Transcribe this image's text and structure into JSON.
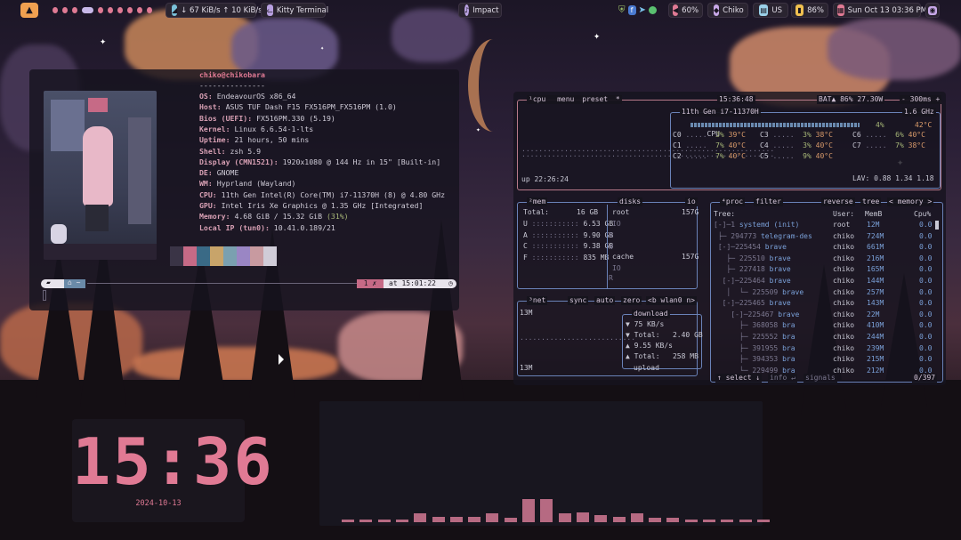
{
  "topbar": {
    "left": {
      "launcher_icon": "arch-logo-icon",
      "net_stats": "↓ 67 KiB/s ↑ 10 KiB/s",
      "active_window": "Kitty Terminal"
    },
    "center": {
      "media": "Impact"
    },
    "right": {
      "tray_icons": [
        "shield-icon",
        "file-icon",
        "telegram-icon",
        "spotify-icon"
      ],
      "volume": "60%",
      "user": "Chiko",
      "keyboard_layout": "US",
      "battery": "86%",
      "datetime": "Sun Oct 13  03:36 PM"
    }
  },
  "fastfetch": {
    "header": "chiko@chikobara",
    "separator": "---------------",
    "lines": [
      {
        "key": "OS:",
        "value": " EndeavourOS x86_64"
      },
      {
        "key": "Host:",
        "value": " ASUS TUF Dash F15 FX516PM_FX516PM (1.0)"
      },
      {
        "key": "Bios (UEFI):",
        "value": " FX516PM.330 (5.19)"
      },
      {
        "key": "Kernel:",
        "value": " Linux 6.6.54-1-lts"
      },
      {
        "key": "Uptime:",
        "value": " 21 hours, 50 mins"
      },
      {
        "key": "Shell:",
        "value": " zsh 5.9"
      },
      {
        "key": "Display (CMN1521):",
        "value": " 1920x1080 @ 144 Hz in 15\" [Built-in]"
      },
      {
        "key": "DE:",
        "value": " GNOME"
      },
      {
        "key": "WM:",
        "value": " Hyprland (Wayland)"
      },
      {
        "key": "CPU:",
        "value": " 11th Gen Intel(R) Core(TM) i7-11370H (8) @ 4.80 GHz"
      },
      {
        "key": "GPU:",
        "value": " Intel Iris Xe Graphics @ 1.35 GHz [Integrated]"
      },
      {
        "key": "Memory:",
        "value": " 4.68 GiB / 15.32 GiB ",
        "extra": "(31%)"
      },
      {
        "key": "Local IP (tun0):",
        "value": " 10.41.0.189/21"
      }
    ],
    "palette": [
      "#3a3446",
      "#c66a86",
      "#3a6a86",
      "#c8a46a",
      "#7aa0b0",
      "#9a86c4",
      "#c89aa0",
      "#d0ccd8"
    ],
    "prompt": {
      "status": "1 ✗",
      "time": "at 15:01:22"
    }
  },
  "btop": {
    "cpu": {
      "tabs": [
        "¹cpu",
        "menu",
        "preset",
        "*"
      ],
      "clock": "15:36:48",
      "battery": "BAT▲ 86% 27.30W",
      "refresh": "- 300ms +",
      "model": "11th Gen i7-11370H",
      "freq": "1.6 GHz",
      "total_label": "CPU",
      "total_pct": "4%",
      "total_temp": "42°C",
      "cores": [
        {
          "name": "C0",
          "pct": "3%",
          "temp": "39°C"
        },
        {
          "name": "C1",
          "pct": "7%",
          "temp": "40°C"
        },
        {
          "name": "C2",
          "pct": "7%",
          "temp": "40°C"
        },
        {
          "name": "C3",
          "pct": "3%",
          "temp": "38°C"
        },
        {
          "name": "C4",
          "pct": "3%",
          "temp": "40°C"
        },
        {
          "name": "C5",
          "pct": "9%",
          "temp": "40°C"
        },
        {
          "name": "C6",
          "pct": "6%",
          "temp": "40°C"
        },
        {
          "name": "C7",
          "pct": "7%",
          "temp": "38°C"
        }
      ],
      "load": "LAV: 0.88 1.34 1.18",
      "uptime": "up 22:26:24"
    },
    "mem": {
      "title": "²mem",
      "total_label": "Total:",
      "total": "16 GB",
      "rows": [
        {
          "k": "U",
          "v": "6.53 GB"
        },
        {
          "k": "A",
          "v": "9.90 GB"
        },
        {
          "k": "C",
          "v": "9.38 GB"
        },
        {
          "k": "F",
          "v": "835 MB"
        }
      ]
    },
    "disks": {
      "title": "disks",
      "io": "io",
      "root": "root",
      "root_size": "157G",
      "cache": "cache",
      "cache_size": "157G",
      "io_label": "IO",
      "r": "R",
      "w": "W"
    },
    "net": {
      "title": "³net",
      "tabs": [
        "sync",
        "auto",
        "zero",
        "<b wlan0 n>"
      ],
      "top_scale": "13M",
      "bottom_scale": "13M",
      "download_label": "download",
      "dl_rate": "▼ 75 KB/s",
      "dl_total": "▼ Total:   2.40 GB",
      "ul_rate": "▲ 9.55 KB/s",
      "ul_total": "▲ Total:   258 MB",
      "upload_label": "upload"
    },
    "proc": {
      "tabs": [
        "⁴proc",
        "filter",
        "reverse",
        "tree",
        "< memory >"
      ],
      "headers": [
        "Tree:",
        "User:",
        "MemB",
        "Cpu%"
      ],
      "rows": [
        {
          "tree": "[-]─1 ",
          "name": "systemd (init)",
          "user": "root",
          "mem": "12M",
          "cpu": "0.0"
        },
        {
          "tree": " ├─ 294773 ",
          "name": "telegram-des",
          "user": "chiko",
          "mem": "724M",
          "cpu": "0.0"
        },
        {
          "tree": " [-]─225454 ",
          "name": "brave",
          "user": "chiko",
          "mem": "661M",
          "cpu": "0.0"
        },
        {
          "tree": "   ├─ 225510 ",
          "name": "brave",
          "user": "chiko",
          "mem": "216M",
          "cpu": "0.0"
        },
        {
          "tree": "   ├─ 227418 ",
          "name": "brave",
          "user": "chiko",
          "mem": "165M",
          "cpu": "0.0"
        },
        {
          "tree": "  [-]─225464 ",
          "name": "brave",
          "user": "chiko",
          "mem": "144M",
          "cpu": "0.0"
        },
        {
          "tree": "   │  └─ 225509 ",
          "name": "brave",
          "user": "chiko",
          "mem": "257M",
          "cpu": "0.0"
        },
        {
          "tree": "  [-]─225465 ",
          "name": "brave",
          "user": "chiko",
          "mem": "143M",
          "cpu": "0.0"
        },
        {
          "tree": "    [-]─225467 ",
          "name": "brave",
          "user": "chiko",
          "mem": "22M",
          "cpu": "0.0"
        },
        {
          "tree": "      ├─ 368058 ",
          "name": "bra",
          "user": "chiko",
          "mem": "410M",
          "cpu": "0.0"
        },
        {
          "tree": "      ├─ 225552 ",
          "name": "bra",
          "user": "chiko",
          "mem": "244M",
          "cpu": "0.0"
        },
        {
          "tree": "      ├─ 391955 ",
          "name": "bra",
          "user": "chiko",
          "mem": "239M",
          "cpu": "0.0"
        },
        {
          "tree": "      ├─ 394353 ",
          "name": "bra",
          "user": "chiko",
          "mem": "215M",
          "cpu": "0.0"
        },
        {
          "tree": "      └─ 229499 ",
          "name": "bra",
          "user": "chiko",
          "mem": "212M",
          "cpu": "0.0"
        }
      ],
      "footer_select": "↑ select ↓",
      "footer_info": "info ↵",
      "footer_signals": "signals",
      "footer_count": "0/397"
    }
  },
  "clock": {
    "time": "15:36",
    "date": "2024-10-13"
  },
  "visualizer": {
    "levels": [
      2,
      2,
      2,
      2,
      6,
      4,
      4,
      4,
      6,
      3,
      16,
      16,
      6,
      7,
      5,
      4,
      6,
      3,
      3,
      2,
      2,
      2,
      2,
      2
    ]
  },
  "colors": {
    "accent_pink": "#e07a94",
    "accent_orange": "#f0a050",
    "border_blue": "#6a82b8",
    "border_pink": "#b87a8a"
  }
}
